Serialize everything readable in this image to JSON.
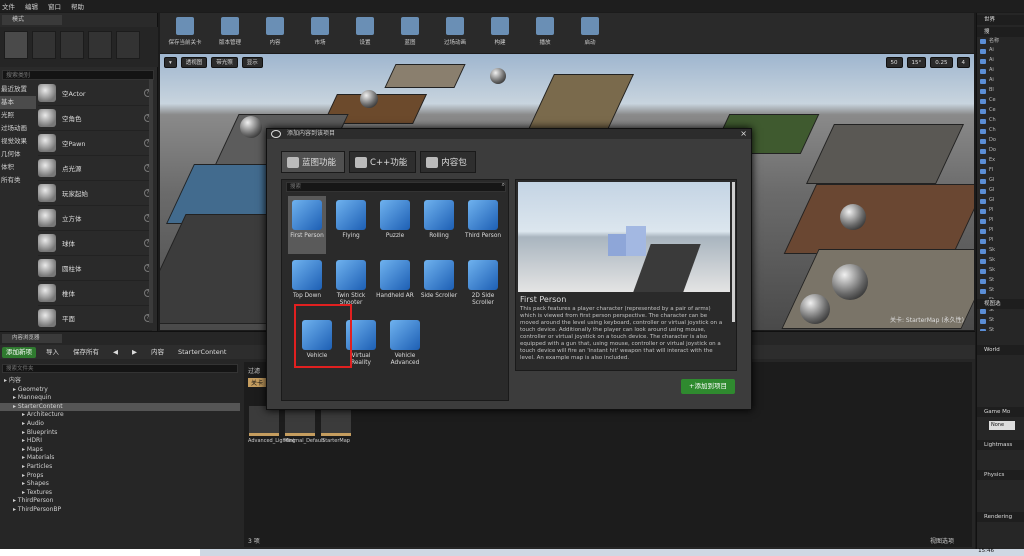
{
  "menubar": {
    "items": [
      "文件",
      "编辑",
      "窗口",
      "帮助"
    ]
  },
  "modes": {
    "tab_label": "模式",
    "search_placeholder": "搜索类别",
    "categories": [
      "最近放置",
      "基本",
      "光照",
      "过场动画",
      "视觉效果",
      "几何体",
      "体积",
      "所有类"
    ],
    "items": [
      "空Actor",
      "空角色",
      "空Pawn",
      "点光源",
      "玩家起始",
      "立方体",
      "球体",
      "圆柱体",
      "椎体",
      "平面"
    ]
  },
  "toolbar": {
    "buttons": [
      "保存当前关卡",
      "版本管理",
      "内容",
      "市场",
      "设置",
      "蓝图",
      "过场动画",
      "构建",
      "播放",
      "启动"
    ]
  },
  "viewport": {
    "buttons": [
      "透视图",
      "带光照",
      "显示"
    ],
    "grid_values": [
      "50",
      "15°",
      "0.25",
      "4"
    ],
    "level_label": "关卡: StarterMap (永久性)"
  },
  "outliner": {
    "tab_label": "世界",
    "search_placeholder": "搜",
    "rows": [
      "名称",
      "Ai",
      "Ai",
      "Ai",
      "Ai",
      "Bl",
      "Ce",
      "Ce",
      "Ch",
      "Ch",
      "Do",
      "Do",
      "Ex",
      "Fl",
      "Gl",
      "Gl",
      "Gl",
      "Pl",
      "Pl",
      "Pl",
      "Pl",
      "Sk",
      "Sk",
      "Sk",
      "St",
      "St",
      "St",
      "St",
      "St",
      "St"
    ],
    "footer": "视图选"
  },
  "details": {
    "sections": [
      "World",
      "Game Mo",
      "Lightmass",
      "Physics",
      "Rendering"
    ],
    "game_mode_value": "None"
  },
  "content_browser": {
    "tab_label": "内容浏览器",
    "add_new": "添加新项",
    "import": "导入",
    "save_all": "保存所有",
    "path_root": "内容",
    "path_current": "StarterContent",
    "search_placeholder": "搜索文件夹",
    "tree": [
      {
        "label": "内容",
        "depth": 0
      },
      {
        "label": "Geometry",
        "depth": 1
      },
      {
        "label": "Mannequin",
        "depth": 1
      },
      {
        "label": "StarterContent",
        "depth": 1,
        "selected": true
      },
      {
        "label": "Architecture",
        "depth": 2
      },
      {
        "label": "Audio",
        "depth": 2
      },
      {
        "label": "Blueprints",
        "depth": 2
      },
      {
        "label": "HDRI",
        "depth": 2
      },
      {
        "label": "Maps",
        "depth": 2
      },
      {
        "label": "Materials",
        "depth": 2
      },
      {
        "label": "Particles",
        "depth": 2
      },
      {
        "label": "Props",
        "depth": 2
      },
      {
        "label": "Shapes",
        "depth": 2
      },
      {
        "label": "Textures",
        "depth": 2
      },
      {
        "label": "ThirdPerson",
        "depth": 1
      },
      {
        "label": "ThirdPersonBP",
        "depth": 1
      }
    ],
    "filter_label": "过滤",
    "level_filter": "关卡",
    "assets": [
      "Advanced_Lighting",
      "Minimal_Default",
      "StarterMap"
    ],
    "item_count": "3 项",
    "view_options": "视图选项"
  },
  "dialog": {
    "title": "添加内容到该项目",
    "tabs": [
      "蓝图功能",
      "C++功能",
      "内容包"
    ],
    "search_placeholder": "搜索",
    "templates": [
      {
        "name": "First Person",
        "selected": true
      },
      {
        "name": "Flying"
      },
      {
        "name": "Puzzle"
      },
      {
        "name": "Rolling"
      },
      {
        "name": "Third Person"
      },
      {
        "name": "Top Down"
      },
      {
        "name": "Twin Stick Shooter"
      },
      {
        "name": "Handheld AR"
      },
      {
        "name": "Side Scroller"
      },
      {
        "name": "2D Side Scroller"
      },
      {
        "name": "Vehicle"
      },
      {
        "name": "Virtual Reality"
      },
      {
        "name": "Vehicle Advanced"
      }
    ],
    "preview_title": "First Person",
    "preview_description": "This pack features a player character (represented by a pair of arms) which is viewed from first person perspective. The character can be moved around the level using keyboard, controller or virtual joystick on a touch device. Additionally the player can look around using mouse, controller or virtual joystick on a touch device. The character is also equipped with a gun that, using mouse, controller or virtual joystick on a touch device will fire an 'instant hit' weapon that will interact with the level.",
    "preview_more": "An example map is also included.",
    "add_button": "添加到项目"
  },
  "taskbar": {
    "time": "15:46"
  },
  "colors": {
    "accent_green": "#2f8a2f",
    "highlight_red": "#e02020",
    "icon_blue": "#1d5fb4"
  }
}
